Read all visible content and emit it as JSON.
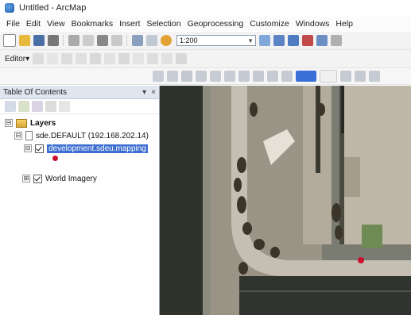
{
  "window": {
    "title": "Untitled - ArcMap"
  },
  "menu": [
    "File",
    "Edit",
    "View",
    "Bookmarks",
    "Insert",
    "Selection",
    "Geoprocessing",
    "Customize",
    "Windows",
    "Help"
  ],
  "toolbar": {
    "scale_value": "1:200",
    "editor_label": "Editor▾"
  },
  "toc": {
    "title": "Table Of Contents",
    "pin": "▾",
    "close": "×",
    "layers_group": "Layers",
    "database": "sde.DEFAULT (192.168.202.14)",
    "selected_layer": "development.sdeu.mapping",
    "world_layer": "World Imagery",
    "expander_open": "⊟",
    "expander_closed": "⊞"
  },
  "colors": {
    "selection": "#3d6fd1",
    "marker": "#c8102e"
  }
}
